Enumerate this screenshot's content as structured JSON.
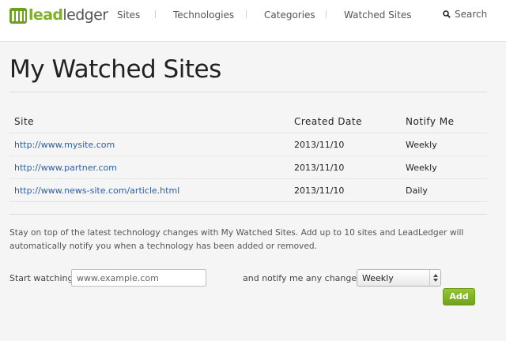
{
  "brand": {
    "lead": "lead",
    "ledger": "ledger",
    "accent": "#7fb12a"
  },
  "nav": {
    "items": [
      {
        "label": "Sites"
      },
      {
        "label": "Technologies"
      },
      {
        "label": "Categories"
      },
      {
        "label": "Watched Sites"
      }
    ],
    "search_label": "Search"
  },
  "page": {
    "title": "My Watched Sites"
  },
  "table": {
    "headers": [
      "Site",
      "Created Date",
      "Notify Me"
    ],
    "rows": [
      {
        "site": "http://www.mysite.com",
        "created": "2013/11/10",
        "notify": "Weekly"
      },
      {
        "site": "http://www.partner.com",
        "created": "2013/11/10",
        "notify": "Weekly"
      },
      {
        "site": "http://www.news-site.com/article.html",
        "created": "2013/11/10",
        "notify": "Daily"
      }
    ]
  },
  "description": "Stay on top of the latest technology changes with My Watched Sites. Add up to 10 sites and LeadLedger will automatically notify you when a technology has been added or removed.",
  "form": {
    "start_label": "Start watching",
    "url_placeholder": "www.example.com",
    "notify_label": "and notify me any changes",
    "frequency_selected": "Weekly",
    "add_label": "Add"
  },
  "colors": {
    "link": "#2a5fa3",
    "button": "#7fb12a"
  }
}
